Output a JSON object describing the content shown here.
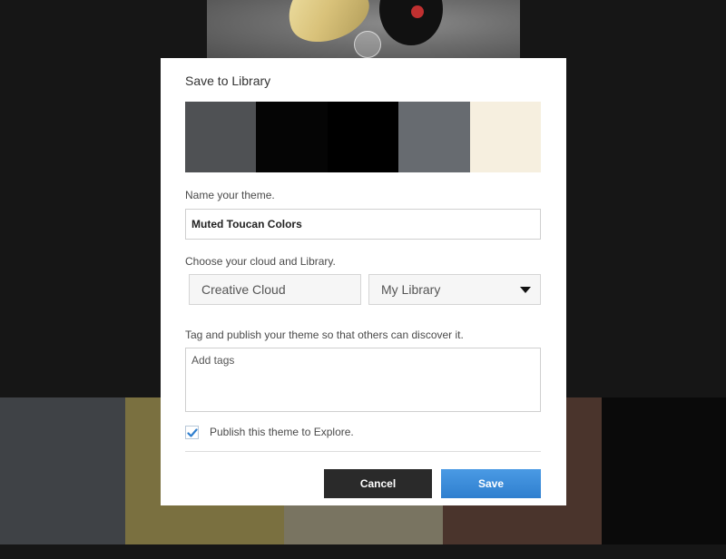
{
  "background": {
    "bottom_swatches": [
      "#3f4246",
      "#7a7040",
      "#797461",
      "#4a342c",
      "#0a0a0a"
    ]
  },
  "dialog": {
    "title": "Save to Library",
    "palette": [
      "#4f5154",
      "#050505",
      "#000000",
      "#676b70",
      "#f6efdf"
    ],
    "name_label": "Name your theme.",
    "name_value": "Muted Toucan Colors",
    "cloud_label": "Choose your cloud and Library.",
    "cloud_value": "Creative Cloud",
    "library_value": "My Library",
    "tags_label": "Tag and publish your theme so that others can discover it.",
    "tags_placeholder": "Add tags",
    "publish_label": "Publish this theme to Explore.",
    "publish_checked": true,
    "cancel_label": "Cancel",
    "save_label": "Save"
  },
  "colors": {
    "accent": "#3a8ad8",
    "cancel_bg": "#2a2a2a"
  },
  "icons": {
    "caret": "chevron-down-icon",
    "check": "checkmark-icon"
  }
}
